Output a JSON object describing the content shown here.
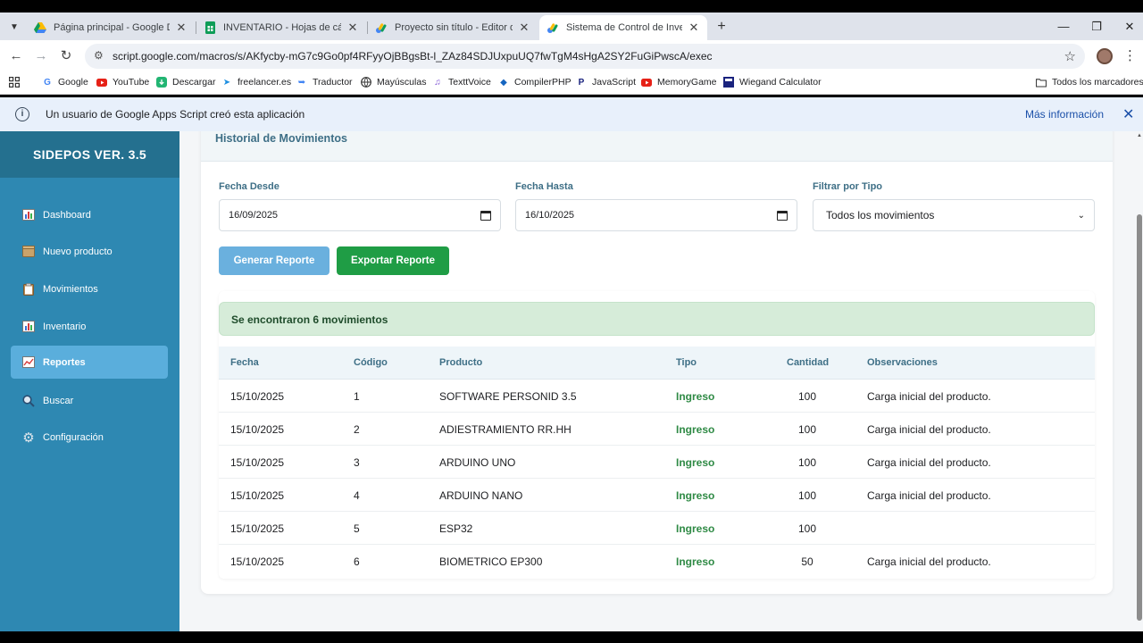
{
  "browser": {
    "tabs": [
      {
        "title": "Página principal - Google Drive",
        "icon": "google-drive-icon",
        "active": false
      },
      {
        "title": "INVENTARIO - Hojas de cálculo",
        "icon": "sheets-icon",
        "active": false
      },
      {
        "title": "Proyecto sin título - Editor del p",
        "icon": "apps-script-icon",
        "active": false
      },
      {
        "title": "Sistema de Control de Inventar",
        "icon": "apps-script-icon",
        "active": true
      }
    ],
    "url": "script.google.com/macros/s/AKfycby-mG7c9Go0pf4RFyyOjBBgsBt-l_ZAz84SDJUxpuUQ7fwTgM4sHgA2SY2FuGiPwscA/exec",
    "bookmarks": [
      {
        "label": "Google",
        "icon": "google-icon"
      },
      {
        "label": "YouTube",
        "icon": "youtube-icon"
      },
      {
        "label": "Descargar",
        "icon": "download-icon"
      },
      {
        "label": "freelancer.es",
        "icon": "freelancer-icon"
      },
      {
        "label": "Traductor",
        "icon": "translate-icon"
      },
      {
        "label": "Mayúsculas",
        "icon": "globe-icon"
      },
      {
        "label": "TexttVoice",
        "icon": "voice-icon"
      },
      {
        "label": "CompilerPHP",
        "icon": "compiler-icon"
      },
      {
        "label": "JavaScript",
        "icon": "javascript-icon"
      },
      {
        "label": "MemoryGame",
        "icon": "youtube-icon"
      },
      {
        "label": "Wiegand Calculator",
        "icon": "wiegand-icon"
      }
    ],
    "all_bookmarks": "Todos los marcadores",
    "infobar": {
      "text": "Un usuario de Google Apps Script creó esta aplicación",
      "link": "Más información"
    }
  },
  "app": {
    "brand": "SIDEPOS VER. 3.5",
    "menu": [
      {
        "label": "Dashboard",
        "icon": "chart-icon",
        "active": false
      },
      {
        "label": "Nuevo producto",
        "icon": "box-icon",
        "active": false
      },
      {
        "label": "Movimientos",
        "icon": "clipboard-icon",
        "active": false
      },
      {
        "label": "Inventario",
        "icon": "chart-icon",
        "active": false
      },
      {
        "label": "Reportes",
        "icon": "trend-icon",
        "active": true
      },
      {
        "label": "Buscar",
        "icon": "search-icon",
        "active": false
      },
      {
        "label": "Configuración",
        "icon": "gear-icon",
        "active": false
      }
    ],
    "section_title": "Historial de Movimientos",
    "filters": {
      "from_label": "Fecha Desde",
      "from_value": "16/09/2025",
      "to_label": "Fecha Hasta",
      "to_value": "16/10/2025",
      "type_label": "Filtrar por Tipo",
      "type_value": "Todos los movimientos"
    },
    "buttons": {
      "generate": "Generar Reporte",
      "export": "Exportar Reporte"
    },
    "result_message": "Se encontraron 6 movimientos",
    "table": {
      "headers": [
        "Fecha",
        "Código",
        "Producto",
        "Tipo",
        "Cantidad",
        "Observaciones"
      ],
      "rows": [
        [
          "15/10/2025",
          "1",
          "SOFTWARE PERSONID 3.5",
          "Ingreso",
          "100",
          "Carga inicial del producto."
        ],
        [
          "15/10/2025",
          "2",
          "ADIESTRAMIENTO RR.HH",
          "Ingreso",
          "100",
          "Carga inicial del producto."
        ],
        [
          "15/10/2025",
          "3",
          "ARDUINO UNO",
          "Ingreso",
          "100",
          "Carga inicial del producto."
        ],
        [
          "15/10/2025",
          "4",
          "ARDUINO NANO",
          "Ingreso",
          "100",
          "Carga inicial del producto."
        ],
        [
          "15/10/2025",
          "5",
          "ESP32",
          "Ingreso",
          "100",
          ""
        ],
        [
          "15/10/2025",
          "6",
          "BIOMETRICO EP300",
          "Ingreso",
          "50",
          "Carga inicial del producto."
        ]
      ]
    },
    "colors": {
      "sidebar": "#2e88b2",
      "brand_bg": "#24708f",
      "active_item": "#5aaedc",
      "generate_btn": "#6ab0de",
      "export_btn": "#1f9d45",
      "ingreso": "#2f8a45"
    }
  }
}
